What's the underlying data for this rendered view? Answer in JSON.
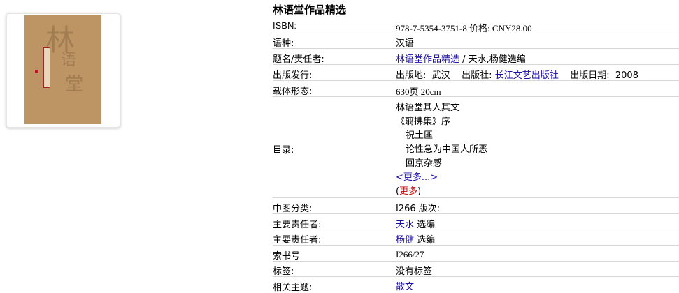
{
  "title": "林语堂作品精选",
  "fields": {
    "isbn_label": "ISBN:",
    "isbn_value": "978-7-5354-3751-8 价格:   CNY28.00",
    "language_label": "语种:",
    "language_value": "汉语",
    "title_author_label": "题名/责任者:",
    "title_link": "林语堂作品精选",
    "title_author_rest": " / 天水,杨健选编",
    "publication_label": "出版发行:",
    "pub_place_text": "出版地:  武汉    出版社: ",
    "publisher_link": "长江文艺出版社",
    "pub_date_text": "    出版日期:  2008",
    "physical_label": "载体形态:",
    "physical_value": "630页 20cm",
    "toc_label": "目录:",
    "toc_items": [
      "林语堂其人其文",
      "《翦拂集》序",
      "祝土匪",
      "论性急为中国人所恶",
      "回京杂感"
    ],
    "toc_more_link": "<更多...>",
    "toc_more2_open": "(",
    "toc_more2_link": "更多",
    "toc_more2_close": ")",
    "clc_label": "中图分类:",
    "clc_value": "I266 版次:",
    "author1_label": "主要责任者:",
    "author1_link": "天水",
    "author1_role": " 选编",
    "author2_label": "主要责任者:",
    "author2_link": "杨健",
    "author2_role": " 选编",
    "callno_label": "索书号",
    "callno_value": "I266/27",
    "tags_label": "标签:",
    "tags_value": "没有标签",
    "subject_label": "相关主题:",
    "subject_link": "散文"
  },
  "cover": {
    "char1": "林",
    "char2": "语",
    "char3": "堂"
  },
  "colors": {
    "link": "#1a0dab",
    "more_red": "#cc0000",
    "cover_bg": "#bd9565"
  }
}
